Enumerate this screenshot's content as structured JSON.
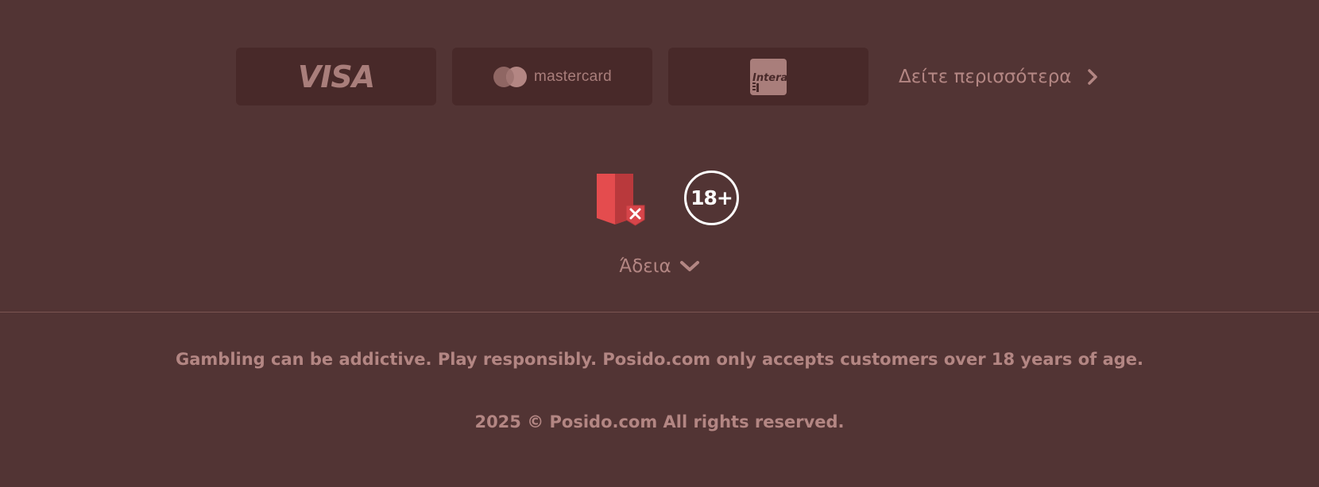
{
  "payments": {
    "visa_label": "VISA",
    "mastercard_label": "mastercard",
    "interac_label": "Interac",
    "see_more_label": "Δείτε περισσότερα"
  },
  "badges": {
    "age_label": "18+"
  },
  "license": {
    "label": "Άδεια"
  },
  "footer": {
    "disclaimer": "Gambling can be addictive. Play responsibly. Posido.com only accepts customers over 18 years of age.",
    "copyright": "2025 © Posido.com All rights reserved."
  },
  "colors": {
    "background": "#523434",
    "card_background": "#482929",
    "text": "#b38683",
    "divider": "#7a5451",
    "shield_red": "#e44c4e"
  }
}
